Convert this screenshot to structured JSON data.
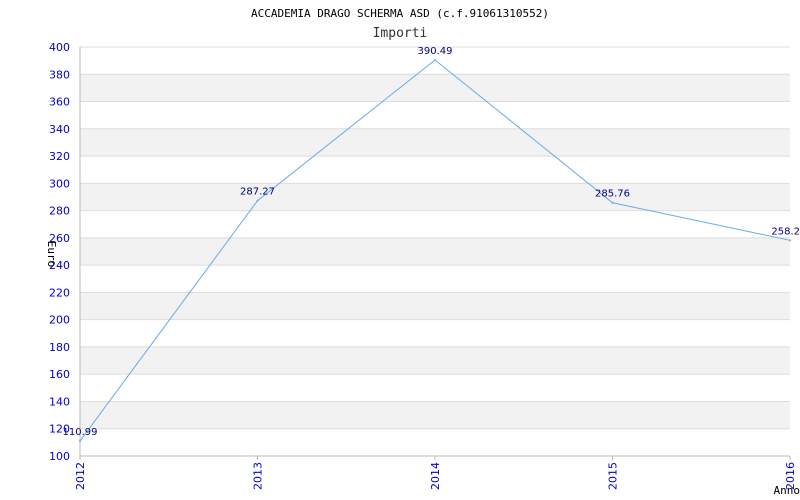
{
  "chart_data": {
    "type": "line",
    "title": "ACCADEMIA DRAGO SCHERMA ASD (c.f.91061310552)",
    "subtitle": "Importi",
    "xlabel": "Anno",
    "ylabel": "Euro",
    "categories": [
      "2012",
      "2013",
      "2014",
      "2015",
      "2016"
    ],
    "series": [
      {
        "values": [
          110.99,
          287.27,
          390.49,
          285.76,
          258.2
        ]
      }
    ],
    "data_labels": [
      "110.99",
      "287.27",
      "390.49",
      "285.76",
      "258.2"
    ],
    "ylim": [
      100,
      400
    ],
    "yticks": [
      100,
      120,
      140,
      160,
      180,
      200,
      220,
      240,
      260,
      280,
      300,
      320,
      340,
      360,
      380,
      400
    ],
    "grid": true,
    "colors": {
      "line": "#66aaee",
      "band": "#f2f2f2",
      "grid": "#dddddd",
      "tick_text": "#0000cc",
      "data_label": "#000080"
    }
  }
}
